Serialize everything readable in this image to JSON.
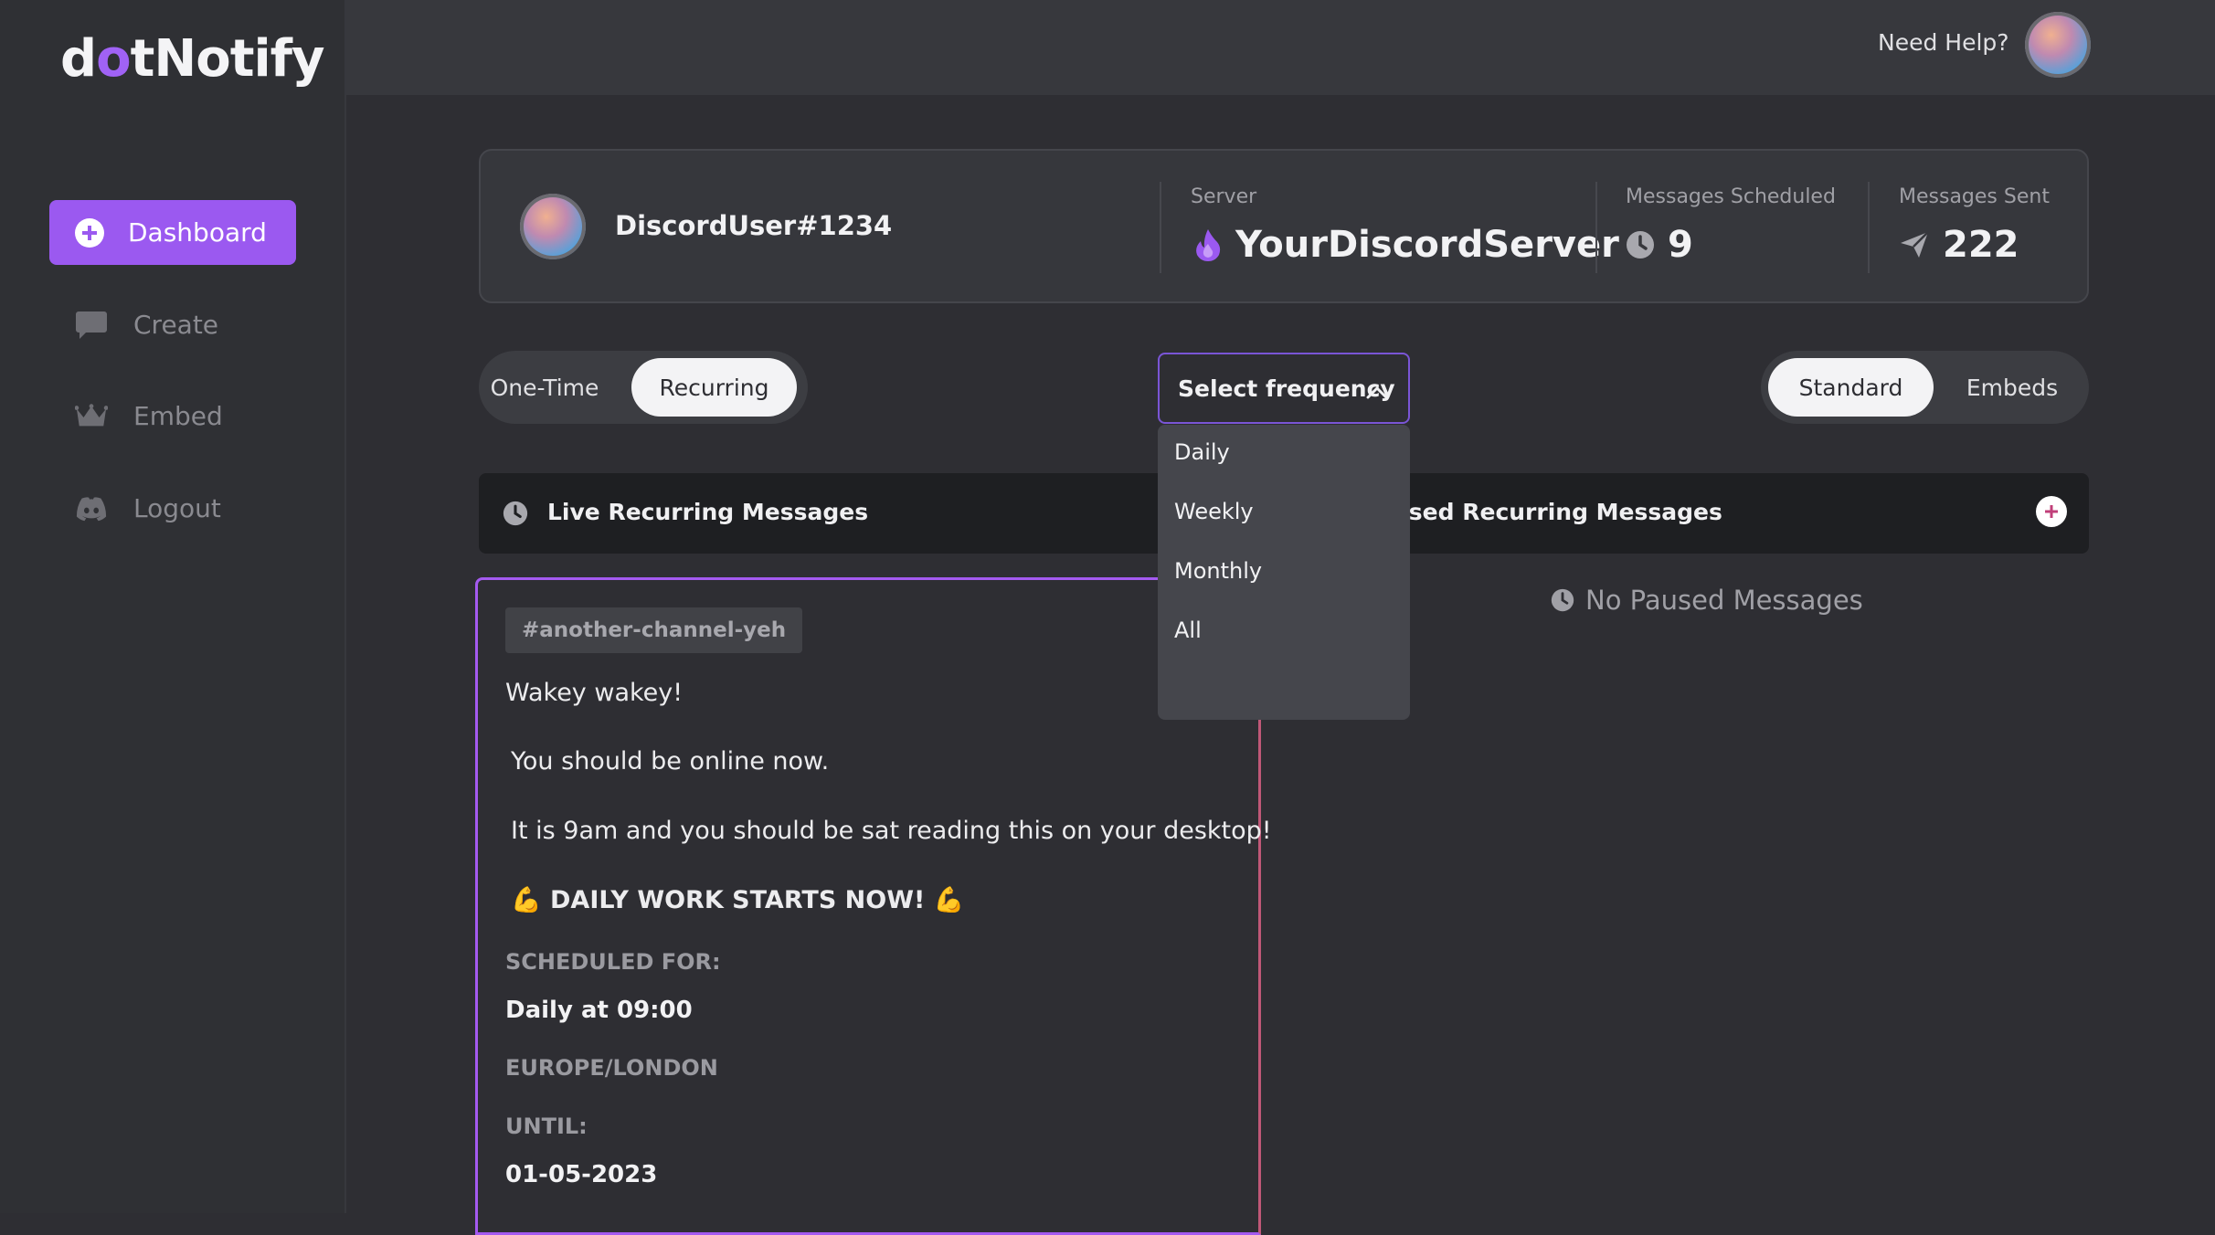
{
  "app": {
    "logo": {
      "prefix": "d",
      "o": "o",
      "suffix": "tNotify"
    }
  },
  "sidebar": {
    "items": [
      {
        "label": "Dashboard",
        "icon": "plus-circle-icon",
        "active": true
      },
      {
        "label": "Create",
        "icon": "chat-bubble-icon",
        "active": false
      },
      {
        "label": "Embed",
        "icon": "crown-icon",
        "active": false
      },
      {
        "label": "Logout",
        "icon": "discord-icon",
        "active": false
      }
    ]
  },
  "header": {
    "help": "Need Help?"
  },
  "stats": {
    "username": "DiscordUser#1234",
    "server_label": "Server",
    "server_name": "YourDiscordServer",
    "scheduled_label": "Messages Scheduled",
    "scheduled_value": "9",
    "sent_label": "Messages Sent",
    "sent_value": "222"
  },
  "toggles": {
    "type": {
      "options": [
        "One-Time",
        "Recurring"
      ],
      "selected": "Recurring"
    },
    "format": {
      "options": [
        "Standard",
        "Embeds"
      ],
      "selected": "Standard"
    }
  },
  "frequency": {
    "label": "Select frequency",
    "options": [
      "Daily",
      "Weekly",
      "Monthly",
      "All"
    ]
  },
  "sections": {
    "live_title": "Live Recurring Messages",
    "paused_title": "Paused Recurring Messages",
    "paused_visible": "used Recurring Messages",
    "no_paused": "No Paused Messages"
  },
  "message": {
    "channel": "#another-channel-yeh",
    "lines": [
      "Wakey wakey!",
      "You should be online now.",
      "It is 9am and you should be sat reading this on your desktop!",
      "💪 DAILY WORK STARTS NOW! 💪"
    ],
    "scheduled_label": "SCHEDULED FOR:",
    "scheduled_value": "Daily at 09:00",
    "timezone": "EUROPE/LONDON",
    "until_label": "UNTIL:",
    "until_value": "01-05-2023"
  },
  "colors": {
    "accent": "#9b59f0",
    "background": "#2e2e33",
    "sidebar": "#2f3034",
    "card": "#36373c",
    "bar": "#1e1f22"
  }
}
